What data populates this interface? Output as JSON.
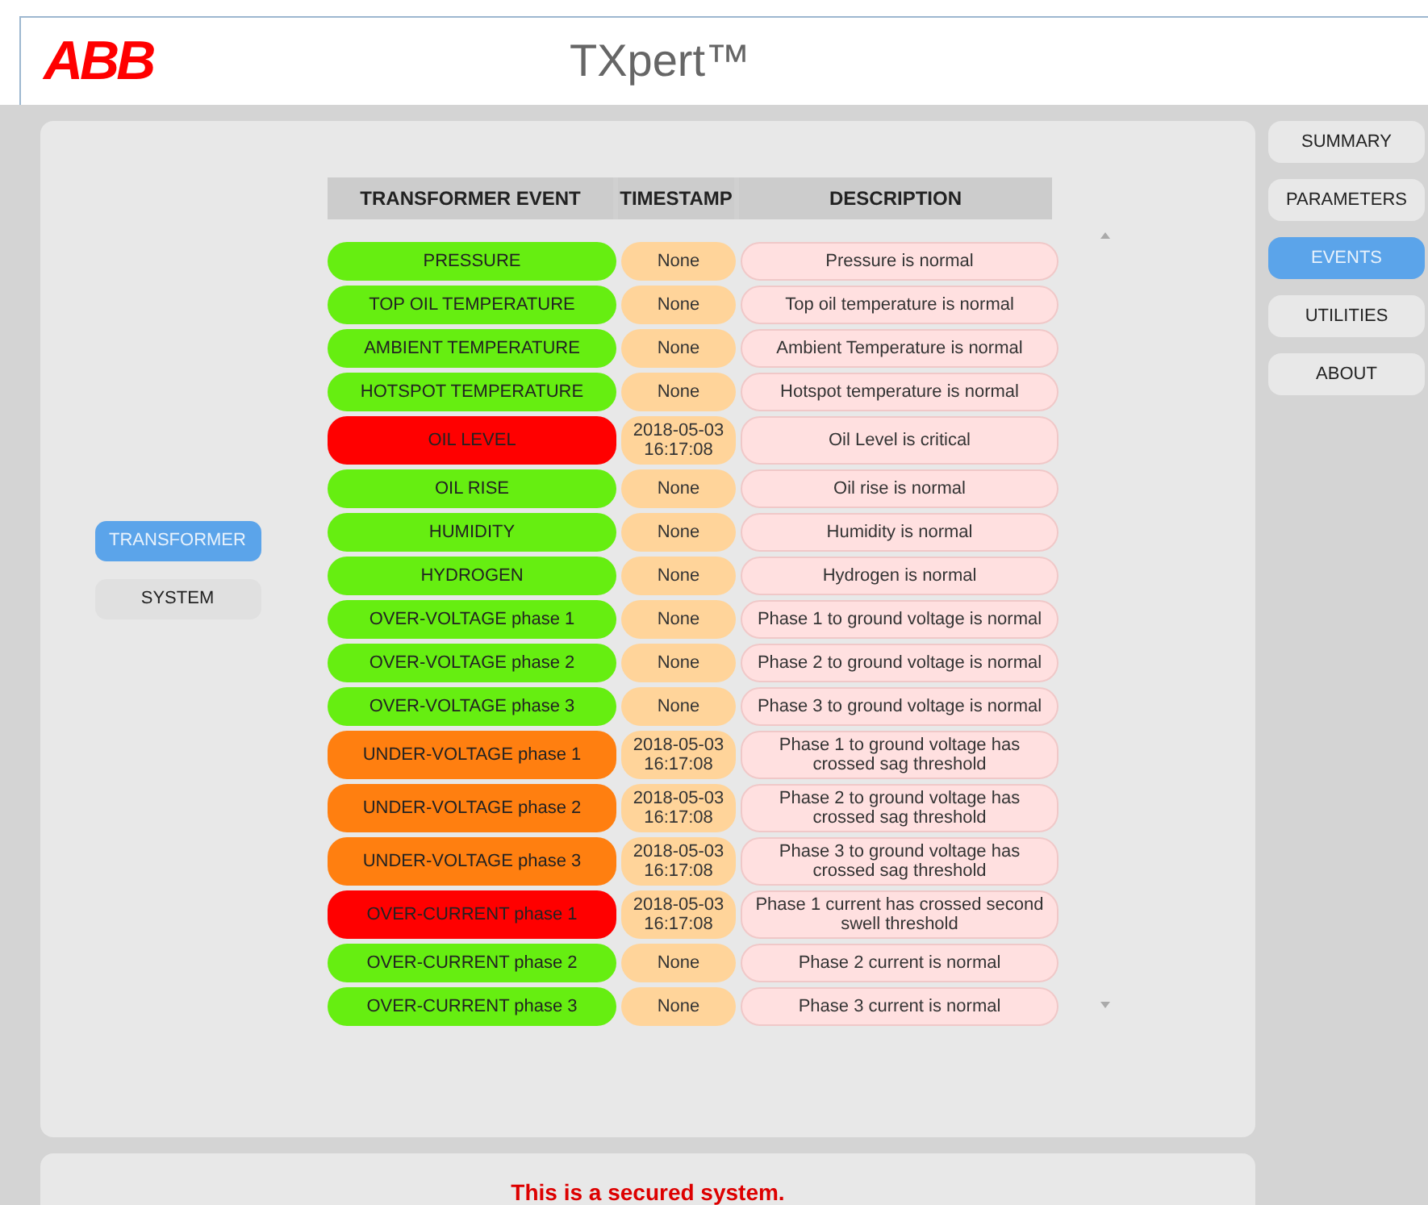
{
  "header": {
    "logo": "ABB",
    "title": "TXpert™"
  },
  "side_tabs": [
    {
      "label": "TRANSFORMER",
      "selected": true
    },
    {
      "label": "SYSTEM",
      "selected": false
    }
  ],
  "table": {
    "columns": [
      "TRANSFORMER EVENT",
      "TIMESTAMP",
      "DESCRIPTION"
    ],
    "rows": [
      {
        "event": "PRESSURE",
        "color": "#66ee11",
        "timestamp": "None",
        "description": "Pressure is normal"
      },
      {
        "event": "TOP OIL TEMPERATURE",
        "color": "#66ee11",
        "timestamp": "None",
        "description": "Top oil temperature is normal"
      },
      {
        "event": "AMBIENT TEMPERATURE",
        "color": "#66ee11",
        "timestamp": "None",
        "description": "Ambient Temperature is normal"
      },
      {
        "event": "HOTSPOT TEMPERATURE",
        "color": "#66ee11",
        "timestamp": "None",
        "description": "Hotspot temperature is normal"
      },
      {
        "event": "OIL LEVEL",
        "color": "#ff0000",
        "timestamp": "2018-05-03 16:17:08",
        "description": "Oil Level is critical"
      },
      {
        "event": "OIL RISE",
        "color": "#66ee11",
        "timestamp": "None",
        "description": "Oil rise is normal"
      },
      {
        "event": "HUMIDITY",
        "color": "#66ee11",
        "timestamp": "None",
        "description": "Humidity is normal"
      },
      {
        "event": "HYDROGEN",
        "color": "#66ee11",
        "timestamp": "None",
        "description": "Hydrogen is normal"
      },
      {
        "event": "OVER-VOLTAGE phase 1",
        "color": "#66ee11",
        "timestamp": "None",
        "description": "Phase 1 to ground voltage is normal"
      },
      {
        "event": "OVER-VOLTAGE phase 2",
        "color": "#66ee11",
        "timestamp": "None",
        "description": "Phase 2 to ground voltage is normal"
      },
      {
        "event": "OVER-VOLTAGE phase 3",
        "color": "#66ee11",
        "timestamp": "None",
        "description": "Phase 3 to ground voltage is normal"
      },
      {
        "event": "UNDER-VOLTAGE phase 1",
        "color": "#ff7f10",
        "timestamp": "2018-05-03 16:17:08",
        "description": "Phase 1 to ground voltage has crossed sag threshold"
      },
      {
        "event": "UNDER-VOLTAGE phase 2",
        "color": "#ff7f10",
        "timestamp": "2018-05-03 16:17:08",
        "description": "Phase 2 to ground voltage has crossed sag threshold"
      },
      {
        "event": "UNDER-VOLTAGE phase 3",
        "color": "#ff7f10",
        "timestamp": "2018-05-03 16:17:08",
        "description": "Phase 3 to ground voltage has crossed sag threshold"
      },
      {
        "event": "OVER-CURRENT phase 1",
        "color": "#ff0000",
        "timestamp": "2018-05-03 16:17:08",
        "description": "Phase 1 current has crossed second swell threshold"
      },
      {
        "event": "OVER-CURRENT phase 2",
        "color": "#66ee11",
        "timestamp": "None",
        "description": "Phase 2 current is normal"
      },
      {
        "event": "OVER-CURRENT phase 3",
        "color": "#66ee11",
        "timestamp": "None",
        "description": "Phase 3 current is normal"
      }
    ]
  },
  "nav": [
    {
      "label": "SUMMARY",
      "selected": false
    },
    {
      "label": "PARAMETERS",
      "selected": false
    },
    {
      "label": "EVENTS",
      "selected": true
    },
    {
      "label": "UTILITIES",
      "selected": false
    },
    {
      "label": "ABOUT",
      "selected": false
    }
  ],
  "footer": {
    "message": "This is a secured system."
  }
}
